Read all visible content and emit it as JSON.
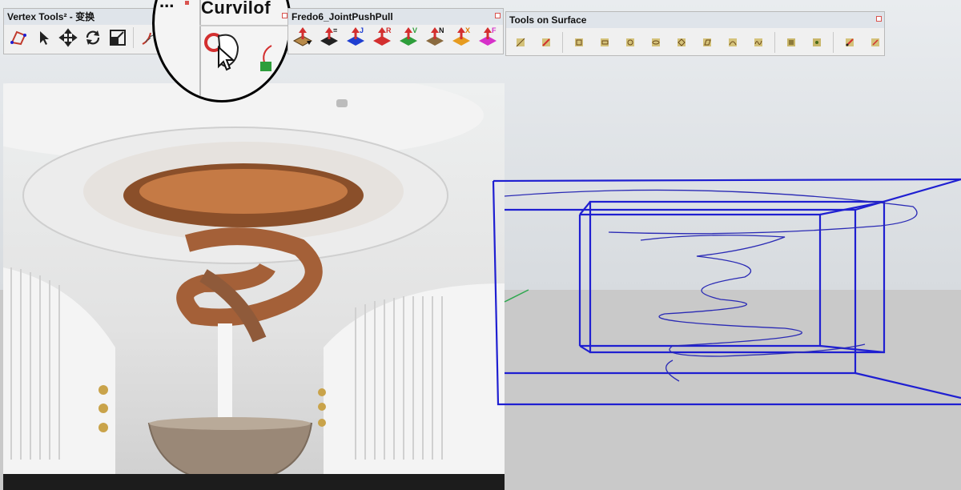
{
  "toolbars": {
    "vertex_tools": {
      "title": "Vertex Tools² - 变换"
    },
    "curviloft": {
      "title": "Curvilof"
    },
    "fredo_jpp": {
      "title": "Fredo6_JointPushPull",
      "letters": [
        "",
        "=",
        "J",
        "R",
        "V",
        "N",
        "X",
        "F"
      ]
    },
    "tools_on_surface": {
      "title": "Tools on Surface"
    }
  },
  "overlay": {
    "dots": "..."
  },
  "colors": {
    "toolbar_bg": "#f0f0f0",
    "wireframe": "#1f1fd1",
    "accent_red": "#d9534f"
  }
}
